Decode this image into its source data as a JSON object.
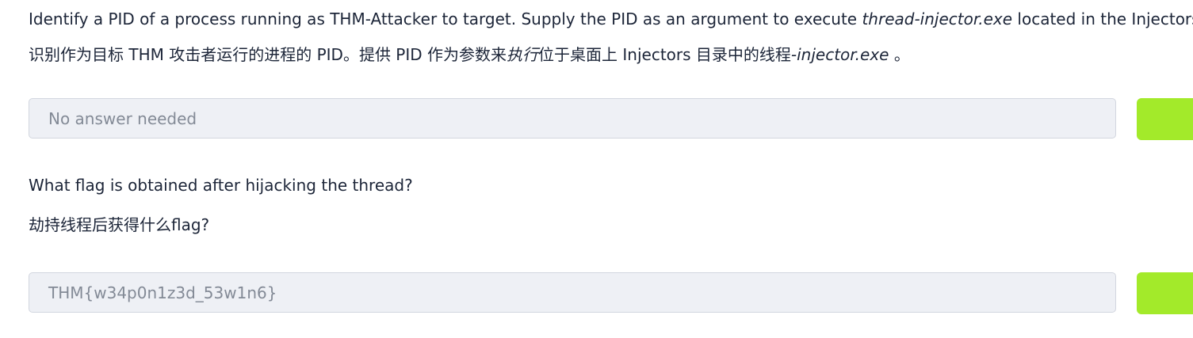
{
  "question1": {
    "en_prefix": "Identify a PID of a process running as THM-Attacker to target. Supply the PID as an argument to execute ",
    "en_italic": "thread-injector.exe",
    "en_suffix": " located in the Injectors di",
    "zh_prefix": "识别作为目标 THM 攻击者运行的进程的 PID。提供 PID 作为参数来",
    "zh_italic1": "执行",
    "zh_middle": "位于桌面上 Injectors 目录中的线程",
    "zh_italic2": "-injector.exe",
    "zh_suffix": " 。",
    "answer_value": "No answer needed"
  },
  "question2": {
    "en": "What flag is obtained after hijacking the thread?",
    "zh": "劫持线程后获得什么flag?",
    "answer_value": "THM{w34p0n1z3d_53w1n6}"
  },
  "colors": {
    "submit_button": "#a3ea2a",
    "field_background": "#eef0f5",
    "text": "#1c2538",
    "field_text": "#838a96"
  }
}
